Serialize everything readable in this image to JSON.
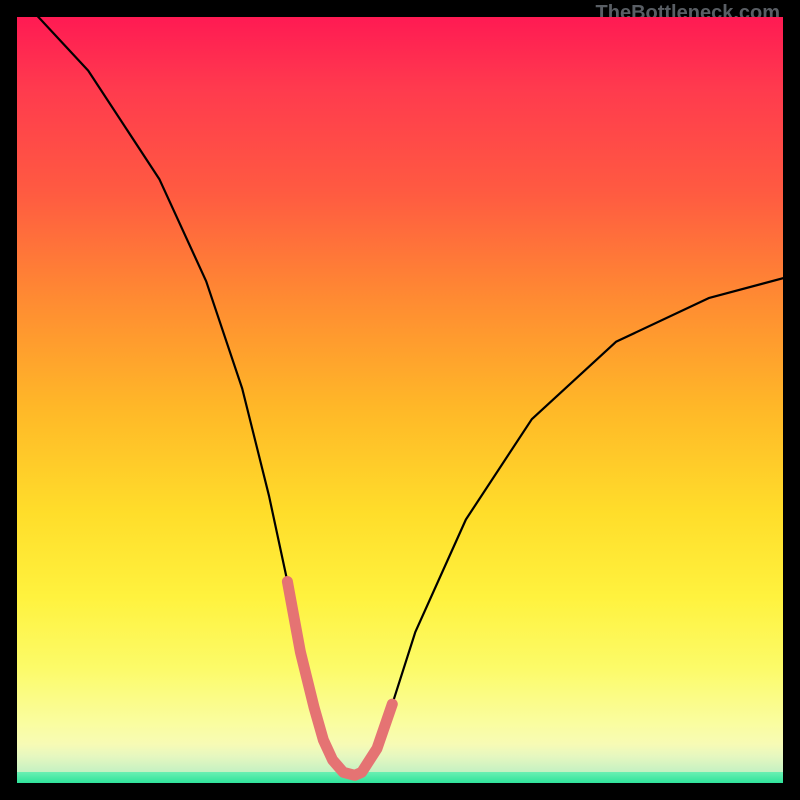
{
  "watermark": {
    "text": "TheBottleneck.com"
  },
  "chart_data": {
    "type": "line",
    "title": "",
    "xlabel": "",
    "ylabel": "",
    "xlim": [
      0,
      100
    ],
    "ylim": [
      0,
      100
    ],
    "series": [
      {
        "name": "bottleneck-curve",
        "x": [
          0,
          9.3,
          18.6,
          24.7,
          29.4,
          32.9,
          35.3,
          37.0,
          38.8,
          40.0,
          41.2,
          42.6,
          44.1,
          45.0,
          47.0,
          49.0,
          52.0,
          58.6,
          67.2,
          78.2,
          90.3,
          100
        ],
        "values": [
          103,
          93.0,
          78.8,
          65.5,
          51.5,
          37.5,
          26.3,
          17.1,
          9.8,
          5.6,
          3.0,
          1.4,
          1.0,
          1.4,
          4.5,
          10.3,
          19.7,
          34.4,
          47.5,
          57.6,
          63.3,
          65.9
        ]
      },
      {
        "name": "near-bottom-highlight",
        "x": [
          35.3,
          37.0,
          38.8,
          40.0,
          41.2,
          42.6,
          44.1,
          45.0,
          47.0,
          49.0
        ],
        "values": [
          26.3,
          17.1,
          9.8,
          5.6,
          3.0,
          1.4,
          1.0,
          1.4,
          4.5,
          10.3
        ]
      }
    ],
    "gradient_stops": {
      "main": [
        "#ff1a53",
        "#ff5b41",
        "#ffb728",
        "#fff23e",
        "#fafda0"
      ],
      "band": [
        "#fafda0",
        "#c5f1c2"
      ],
      "bottom": [
        "#6bf0b2",
        "#2fe39b"
      ]
    },
    "highlight_color": "#e57373"
  }
}
